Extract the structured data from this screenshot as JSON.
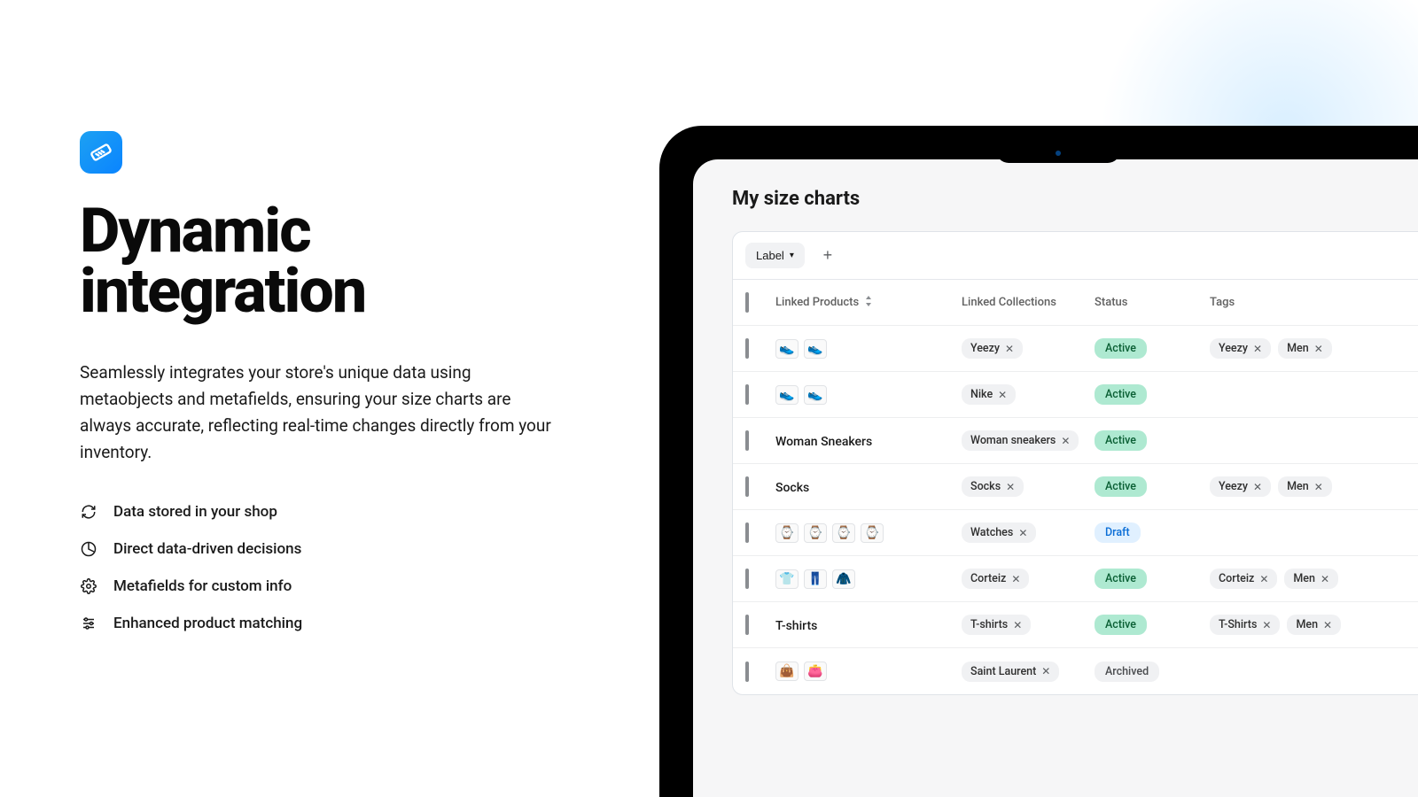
{
  "headline_line1": "Dynamic",
  "headline_line2": "integration",
  "description": "Seamlessly integrates your store's unique data using metaobjects and metafields, ensuring your size charts are always accurate, reflecting real-time changes directly from your inventory.",
  "features": [
    {
      "icon": "refresh-icon",
      "text": "Data stored in your shop"
    },
    {
      "icon": "piechart-icon",
      "text": "Direct data-driven decisions"
    },
    {
      "icon": "gear-icon",
      "text": "Metafields for custom info"
    },
    {
      "icon": "sliders-icon",
      "text": "Enhanced product matching"
    }
  ],
  "panel": {
    "title": "My size charts",
    "filter_label": "Label",
    "columns": {
      "products": "Linked Products",
      "collections": "Linked Collections",
      "status": "Status",
      "tags": "Tags"
    },
    "rows": [
      {
        "product_type": "thumbs",
        "thumbs": [
          "👟",
          "👟"
        ],
        "product_text": "",
        "collection": "Yeezy",
        "status": "Active",
        "tags": [
          "Yeezy",
          "Men"
        ]
      },
      {
        "product_type": "thumbs",
        "thumbs": [
          "👟",
          "👟"
        ],
        "product_text": "",
        "collection": "Nike",
        "status": "Active",
        "tags": []
      },
      {
        "product_type": "text",
        "thumbs": [],
        "product_text": "Woman Sneakers",
        "collection": "Woman sneakers",
        "status": "Active",
        "tags": []
      },
      {
        "product_type": "text",
        "thumbs": [],
        "product_text": "Socks",
        "collection": "Socks",
        "status": "Active",
        "tags": [
          "Yeezy",
          "Men"
        ]
      },
      {
        "product_type": "thumbs",
        "thumbs": [
          "⌚",
          "⌚",
          "⌚",
          "⌚"
        ],
        "product_text": "",
        "collection": "Watches",
        "status": "Draft",
        "tags": []
      },
      {
        "product_type": "thumbs",
        "thumbs": [
          "👕",
          "👖",
          "🧥"
        ],
        "product_text": "",
        "collection": "Corteiz",
        "status": "Active",
        "tags": [
          "Corteiz",
          "Men"
        ]
      },
      {
        "product_type": "text",
        "thumbs": [],
        "product_text": "T-shirts",
        "collection": "T-shirts",
        "status": "Active",
        "tags": [
          "T-Shirts",
          "Men"
        ]
      },
      {
        "product_type": "thumbs",
        "thumbs": [
          "👜",
          "👛"
        ],
        "product_text": "",
        "collection": "Saint Laurent",
        "status": "Archived",
        "tags": []
      }
    ]
  }
}
